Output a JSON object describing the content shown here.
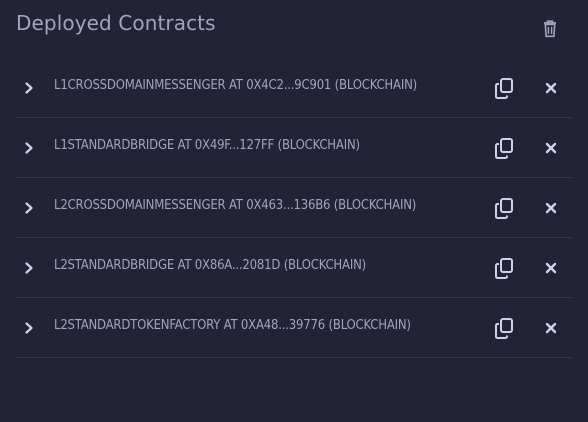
{
  "panel": {
    "title": "Deployed Contracts",
    "clear_icon": "trash-icon"
  },
  "contracts": [
    {
      "label": "L1CROSSDOMAINMESSENGER AT 0X4C2...9C901 (BLOCKCHAIN)"
    },
    {
      "label": "L1STANDARDBRIDGE AT 0X49F...127FF (BLOCKCHAIN)"
    },
    {
      "label": "L2CROSSDOMAINMESSENGER AT 0X463...136B6 (BLOCKCHAIN)"
    },
    {
      "label": "L2STANDARDBRIDGE AT 0X86A...2081D (BLOCKCHAIN)"
    },
    {
      "label": "L2STANDARDTOKENFACTORY AT 0XA48...39776 (BLOCKCHAIN)"
    }
  ],
  "icons": {
    "expand": "chevron-right-icon",
    "copy": "copy-icon",
    "remove": "close-icon"
  },
  "colors": {
    "background": "#222336",
    "text": "#a2a3bd",
    "icon": "#d0d2ea",
    "divider": "#33354a"
  }
}
